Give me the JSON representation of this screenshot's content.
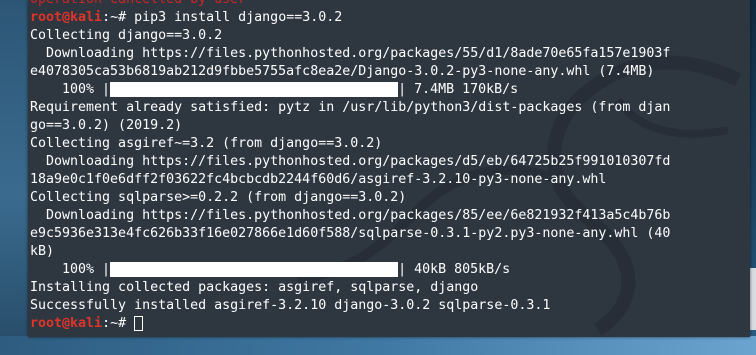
{
  "terminal": {
    "top_partial": "Operation cancelled by user",
    "prompt_user": "root@kali",
    "prompt_sep": ":~# ",
    "command": "pip3 install django==3.0.2",
    "lines": {
      "l2": "Collecting django==3.0.2",
      "l3": "  Downloading https://files.pythonhosted.org/packages/55/d1/8ade70e65fa157e1903f",
      "l4": "e4078305ca53b6819ab212d9fbbe5755afc8ea2e/Django-3.0.2-py3-none-any.whl (7.4MB)",
      "l5_prefix": "    100% |",
      "l5_suffix": "| 7.4MB 170kB/s",
      "l6": "Requirement already satisfied: pytz in /usr/lib/python3/dist-packages (from djan",
      "l7": "go==3.0.2) (2019.2)",
      "l8": "Collecting asgiref~=3.2 (from django==3.0.2)",
      "l9": "  Downloading https://files.pythonhosted.org/packages/d5/eb/64725b25f991010307fd",
      "l10": "18a9e0c1f0e6dff2f03622fc4bcbcdb2244f60d6/asgiref-3.2.10-py3-none-any.whl",
      "l11": "Collecting sqlparse>=0.2.2 (from django==3.0.2)",
      "l12": "  Downloading https://files.pythonhosted.org/packages/85/ee/6e821932f413a5c4b76b",
      "l13": "e9c5936e313e4fc626b33f16e027866e1d60f588/sqlparse-0.3.1-py2.py3-none-any.whl (40",
      "l14": "kB)",
      "l15_prefix": "    100% |",
      "l15_suffix": "| 40kB 805kB/s",
      "l16": "Installing collected packages: asgiref, sqlparse, django",
      "l17": "Successfully installed asgiref-3.2.10 django-3.0.2 sqlparse-0.3.1"
    },
    "progress": [
      1.0,
      1.0
    ],
    "colors": {
      "background": "#2e3640",
      "text": "#ffffff",
      "prompt": "#e0342a",
      "error": "#d02525"
    }
  }
}
